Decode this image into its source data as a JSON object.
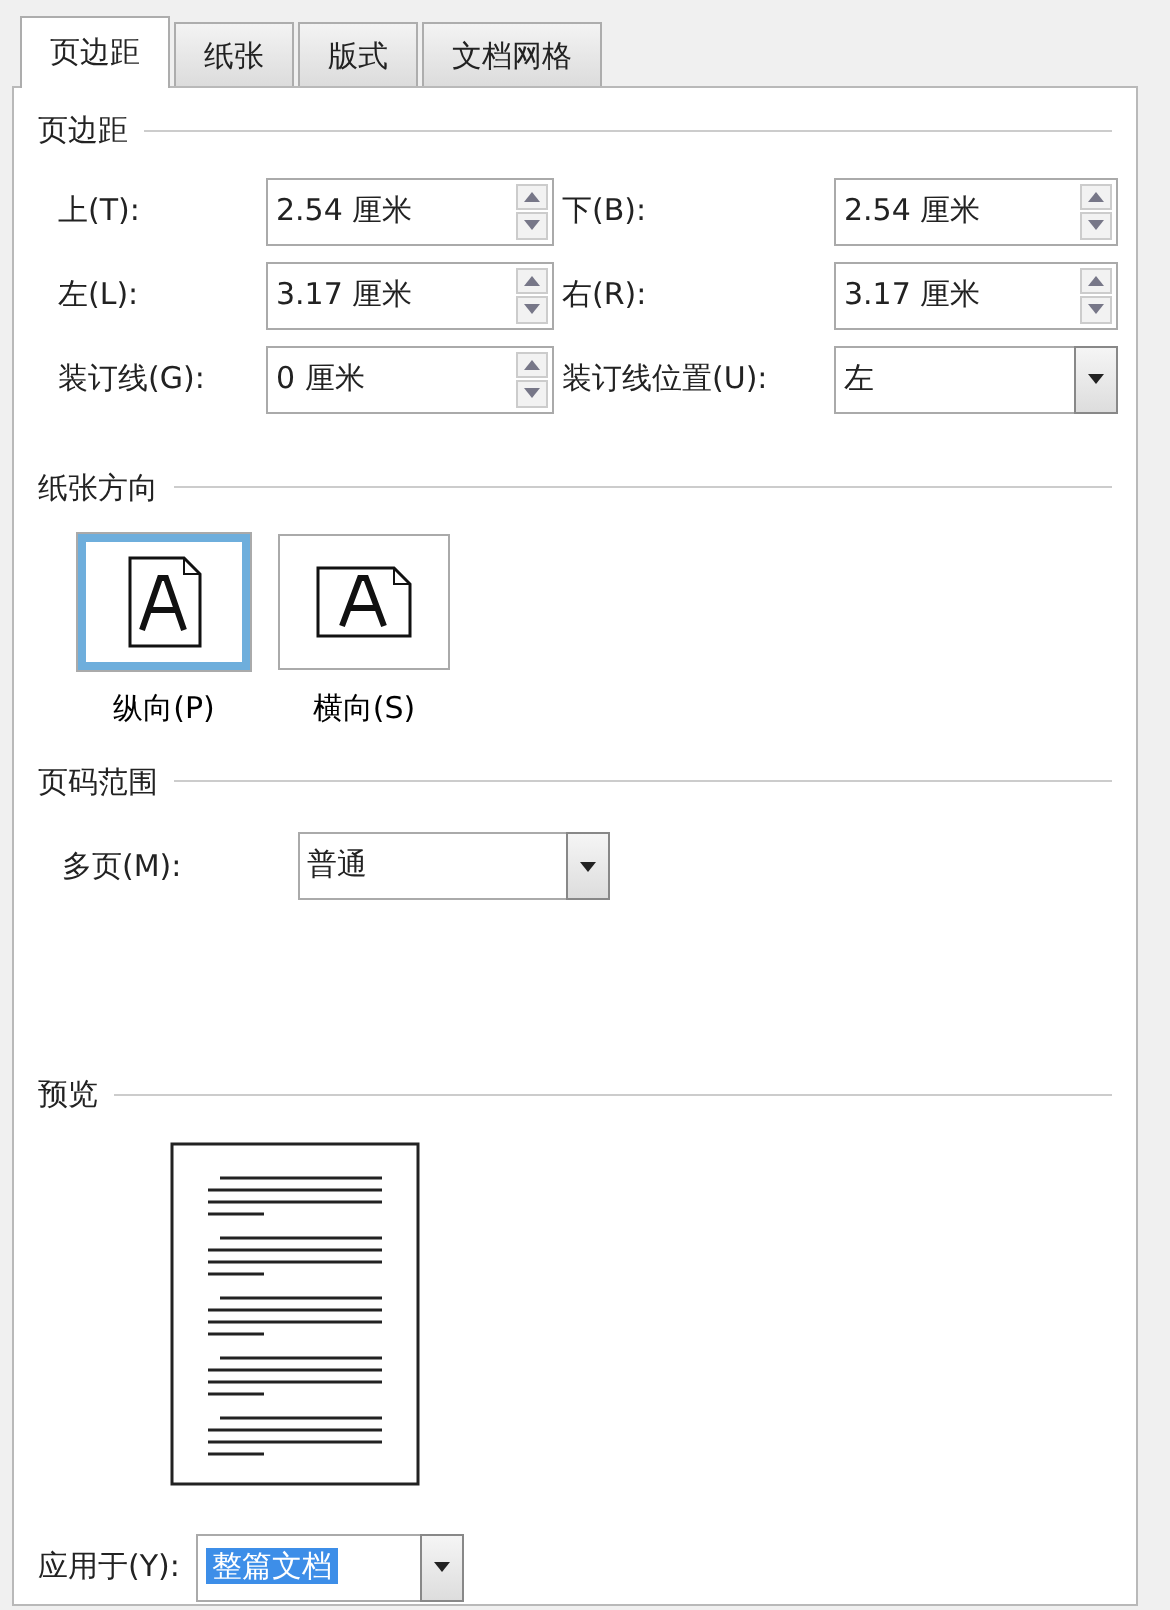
{
  "tabs": [
    {
      "label": "页边距",
      "selected": true
    },
    {
      "label": "纸张",
      "selected": false
    },
    {
      "label": "版式",
      "selected": false
    },
    {
      "label": "文档网格",
      "selected": false
    }
  ],
  "margins": {
    "heading": "页边距",
    "fields": [
      {
        "label": "上(T):",
        "value": "2.54 厘米",
        "kind": "spin"
      },
      {
        "label": "下(B):",
        "value": "2.54 厘米",
        "kind": "spin"
      },
      {
        "label": "左(L):",
        "value": "3.17 厘米",
        "kind": "spin"
      },
      {
        "label": "右(R):",
        "value": "3.17 厘米",
        "kind": "spin"
      },
      {
        "label": "装订线(G):",
        "value": "0 厘米",
        "kind": "spin"
      },
      {
        "label": "装订线位置(U):",
        "value": "左",
        "kind": "dropdown"
      }
    ]
  },
  "orientation": {
    "heading": "纸张方向",
    "options": [
      {
        "label": "纵向(P)",
        "kind": "portrait",
        "selected": true
      },
      {
        "label": "横向(S)",
        "kind": "landscape",
        "selected": false
      }
    ]
  },
  "pages": {
    "heading": "页码范围",
    "label": "多页(M):",
    "value": "普通"
  },
  "preview": {
    "heading": "预览"
  },
  "apply": {
    "label": "应用于(Y):",
    "value": "整篇文档",
    "highlighted": true
  }
}
